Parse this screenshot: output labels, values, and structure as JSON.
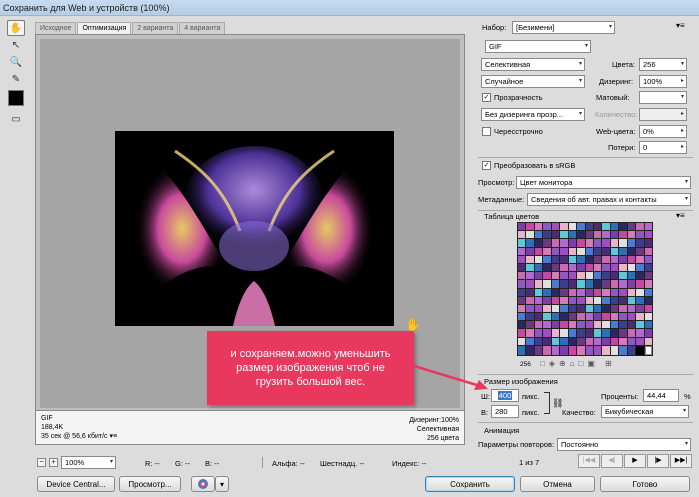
{
  "window": {
    "title": "Сохранить для Web и устройств (100%)"
  },
  "tabs": [
    "Исходное",
    "Оптимизация",
    "2 варианта",
    "4 варианта"
  ],
  "active_tab": 1,
  "image_info": {
    "format": "GIF",
    "size": "188,4K",
    "time": "35 сек @ 56,6 кбит/с",
    "dither": "Дизеринг:100%",
    "palette": "Селективная",
    "colors": "256 цвета"
  },
  "status": {
    "zoom": "100%",
    "r": "R: --",
    "g": "G: --",
    "b": "B: --",
    "alpha": "Альфа: --",
    "hex": "Шестнадц. --",
    "index": "Индекс: --"
  },
  "bottom_buttons": {
    "device_central": "Device Central...",
    "preview": "Просмотр...",
    "save": "Сохранить",
    "cancel": "Отмена",
    "done": "Готово"
  },
  "settings": {
    "preset_label": "Набор:",
    "preset_value": "[Безимени]",
    "format": "GIF",
    "palette": "Селективная",
    "colors_label": "Цвета:",
    "colors_value": "256",
    "dither_algo": "Случайное",
    "dither_label": "Дизеринг:",
    "dither_value": "100%",
    "transparency_label": "Прозрачность",
    "transparency_checked": true,
    "matte_label": "Матовый:",
    "matte_value": "",
    "transp_dither": "Без дизеринга прозр...",
    "amount_label": "Количество:",
    "interlaced_label": "Чересстрочно",
    "interlaced_checked": false,
    "web_colors_label": "Web-цвета:",
    "web_colors_value": "0%",
    "lossy_label": "Потери:",
    "lossy_value": "0",
    "srgb_label": "Преобразовать в sRGB",
    "srgb_checked": true,
    "preview_label": "Просмотр:",
    "preview_value": "Цвет монитора",
    "metadata_label": "Метаданные:",
    "metadata_value": "Сведения об авт. правах и контакты"
  },
  "color_table": {
    "title": "Таблица цветов",
    "count": "256"
  },
  "image_size": {
    "title": "Размер изображения",
    "w_label": "Ш:",
    "w_value": "400",
    "h_label": "В:",
    "h_value": "280",
    "unit": "пикс.",
    "percent_label": "Проценты:",
    "percent_value": "44,44",
    "percent_unit": "%",
    "quality_label": "Качество:",
    "quality_value": "Бикубическая"
  },
  "animation": {
    "title": "Анимация",
    "loop_label": "Параметры повторов:",
    "loop_value": "Постоянно",
    "frame": "1 из 7"
  },
  "annotation": {
    "lines": [
      "и сохраняем.можно уменьшить",
      "размер изображения чтоб не",
      "грузить большой вес."
    ],
    "color": "#e8385e"
  },
  "palette_colors": [
    "#7b3fa8",
    "#4a7bd4",
    "#c86bb0",
    "#e9b3c8",
    "#2b2760",
    "#8c5ac2",
    "#5ec8d8",
    "#c54a9f",
    "#3d3d8c",
    "#b06ad0",
    "#e0e0e0",
    "#6b3a7e",
    "#9e4fc1",
    "#2d6fb8",
    "#d67ab8",
    "#4b2c72"
  ]
}
